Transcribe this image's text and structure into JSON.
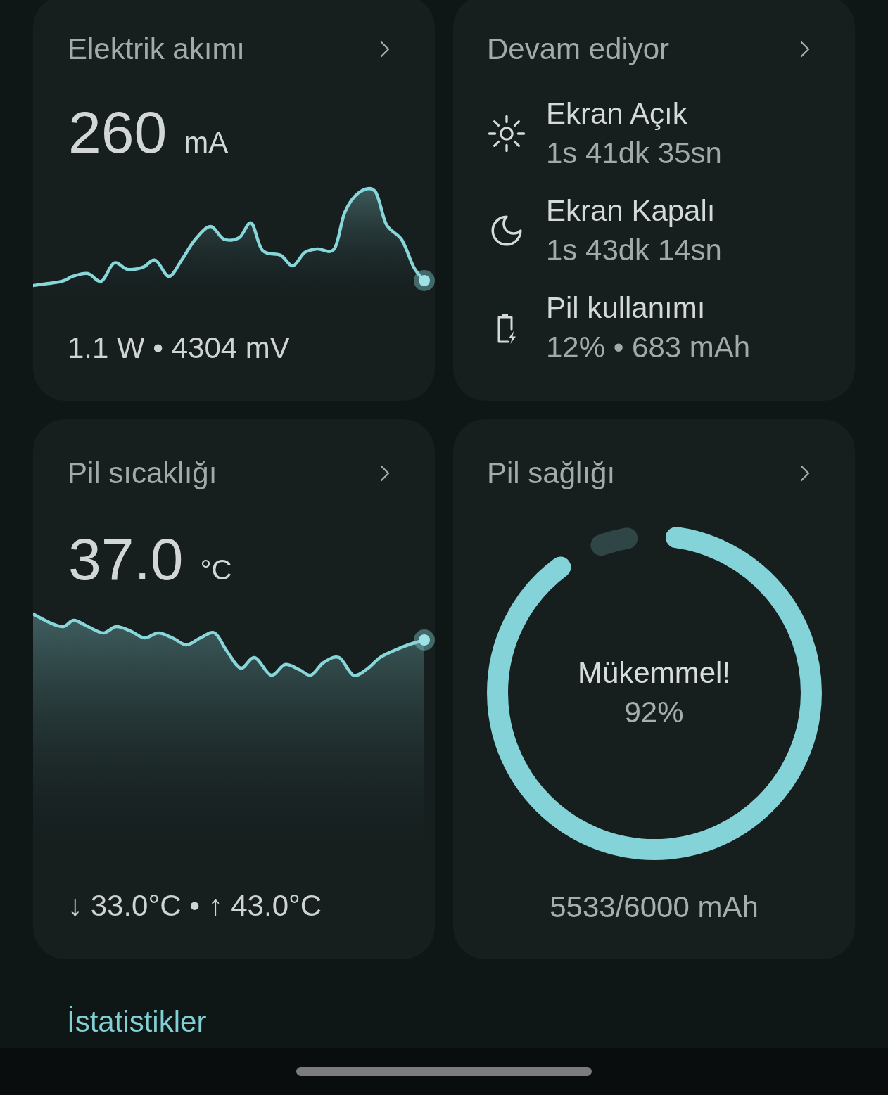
{
  "current": {
    "title": "Elektrik akımı",
    "value": "260",
    "unit": "mA",
    "details": "1.1 W • 4304 mV"
  },
  "ongoing": {
    "title": "Devam ediyor",
    "items": [
      {
        "kind": "screen_on",
        "label": "Ekran Açık",
        "value": "1s 41dk 35sn"
      },
      {
        "kind": "screen_off",
        "label": "Ekran Kapalı",
        "value": "1s 43dk 14sn"
      },
      {
        "kind": "battery_usage",
        "label": "Pil kullanımı",
        "value": "12% • 683 mAh"
      }
    ]
  },
  "temperature": {
    "title": "Pil sıcaklığı",
    "value": "37.0",
    "unit": "°C",
    "range": "↓ 33.0°C • ↑ 43.0°C"
  },
  "health": {
    "title": "Pil sağlığı",
    "status": "Mükemmel!",
    "percent": "92%",
    "level": 0.92,
    "capacity": "5533/6000 mAh"
  },
  "section_title": "İstatistikler"
}
